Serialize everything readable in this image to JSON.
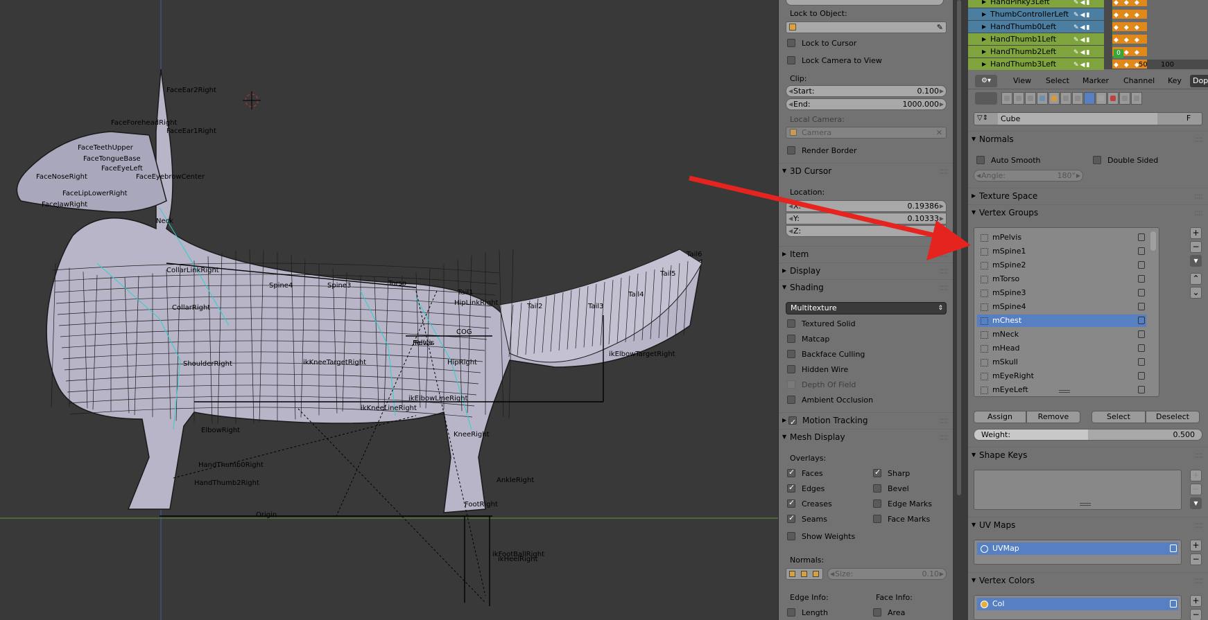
{
  "viewport": {
    "bone_labels": [
      "FaceEar2Right",
      "FaceEar1Right",
      "FaceForeheadRight",
      "Neck",
      "CollarLinkRight",
      "CollarRight",
      "Spine4",
      "Spine3",
      "Torso",
      "Tail1",
      "Tail2",
      "Tail3",
      "Tail4",
      "Tail5",
      "Tail6",
      "HipLinkRight",
      "COG",
      "Pelvis",
      "Pelvis",
      "HipRight",
      "ShoulderRight",
      "ikKneeTargetRight",
      "ikElbowTargetRight",
      "ElbowRight",
      "KneeRight",
      "ikElbowLineRight",
      "ikKneeLineRight",
      "HandThumb0Right",
      "HandThumb2Right",
      "AnkleRight",
      "FootRight",
      "ikFootBallRight",
      "ikHeelRight",
      "Origin",
      "FaceNoseRight",
      "FaceJawRight",
      "FaceTeethUpper",
      "FaceEyeLeft",
      "FaceEyebrowCenter",
      "FaceTongueBase",
      "FaceLipLowerRight"
    ]
  },
  "npanel": {
    "lock_to_object_label": "Lock to Object:",
    "lock_to_cursor": "Lock to Cursor",
    "lock_camera_to_view": "Lock Camera to View",
    "clip_label": "Clip:",
    "clip_start_label": "Start:",
    "clip_start_value": "0.100",
    "clip_end_label": "End:",
    "clip_end_value": "1000.000",
    "local_camera_label": "Local Camera:",
    "camera_placeholder": "Camera",
    "render_border": "Render Border",
    "cursor_panel": "3D Cursor",
    "location_label": "Location:",
    "x_label": "X:",
    "x_value": "0.19386",
    "y_label": "Y:",
    "y_value": "0.10333",
    "z_label": "Z:",
    "z_value": "",
    "item_panel": "Item",
    "display_panel": "Display",
    "shading_panel": "Shading",
    "shading_mode": "Multitexture",
    "shading_options": [
      {
        "label": "Textured Solid",
        "checked": false,
        "enabled": true
      },
      {
        "label": "Matcap",
        "checked": false,
        "enabled": true
      },
      {
        "label": "Backface Culling",
        "checked": false,
        "enabled": true
      },
      {
        "label": "Hidden Wire",
        "checked": false,
        "enabled": true
      },
      {
        "label": "Depth Of Field",
        "checked": false,
        "enabled": false
      },
      {
        "label": "Ambient Occlusion",
        "checked": false,
        "enabled": true
      }
    ],
    "motion_tracking_panel": "Motion Tracking",
    "mesh_display_panel": "Mesh Display",
    "overlays_label": "Overlays:",
    "overlays_left": [
      {
        "label": "Faces",
        "checked": true
      },
      {
        "label": "Edges",
        "checked": true
      },
      {
        "label": "Creases",
        "checked": true
      },
      {
        "label": "Seams",
        "checked": true
      }
    ],
    "overlays_right": [
      {
        "label": "Sharp",
        "checked": true
      },
      {
        "label": "Bevel",
        "checked": false
      },
      {
        "label": "Edge Marks",
        "checked": false
      },
      {
        "label": "Face Marks",
        "checked": false
      }
    ],
    "show_weights": "Show Weights",
    "normals_label": "Normals:",
    "size_label": "Size:",
    "size_value": "0.10",
    "edge_info_label": "Edge Info:",
    "face_info_label": "Face Info:",
    "edge_length": "Length",
    "face_area": "Area"
  },
  "dopesheet": {
    "tracks": [
      {
        "name": "HandPinky3Left",
        "color": "#7fa43d"
      },
      {
        "name": "ThumbControllerLeft",
        "color": "#4b7ea0"
      },
      {
        "name": "HandThumb0Left",
        "color": "#4b7ea0"
      },
      {
        "name": "HandThumb1Left",
        "color": "#7fa43d"
      },
      {
        "name": "HandThumb2Left",
        "color": "#7fa43d"
      },
      {
        "name": "HandThumb3Left",
        "color": "#7fa43d"
      }
    ],
    "frame_current": "0",
    "frame_ticks": [
      "50",
      "100"
    ],
    "menu": [
      "View",
      "Select",
      "Marker",
      "Channel",
      "Key"
    ],
    "mode_label": "Dope"
  },
  "properties": {
    "mesh_name": "Cube",
    "fake_user": "F",
    "normals_panel": "Normals",
    "auto_smooth": "Auto Smooth",
    "double_sided": "Double Sided",
    "angle_label": "Angle:",
    "angle_value": "180°",
    "texture_space_panel": "Texture Space",
    "vertex_groups_panel": "Vertex Groups",
    "vertex_groups": [
      "mPelvis",
      "mSpine1",
      "mSpine2",
      "mTorso",
      "mSpine3",
      "mSpine4",
      "mChest",
      "mNeck",
      "mHead",
      "mSkull",
      "mEyeRight",
      "mEyeLeft"
    ],
    "active_group": "mChest",
    "assign": "Assign",
    "remove": "Remove",
    "select": "Select",
    "deselect": "Deselect",
    "weight_label": "Weight:",
    "weight_value": "0.500",
    "weight_fraction": 0.5,
    "shape_keys_panel": "Shape Keys",
    "uv_maps_panel": "UV Maps",
    "uv_map": "UVMap",
    "vertex_colors_panel": "Vertex Colors",
    "vertex_color": "Col"
  },
  "colors": {
    "accent": "#5680c2",
    "arrow": "#e52420",
    "panel": "#727272",
    "viewport": "#393939"
  }
}
